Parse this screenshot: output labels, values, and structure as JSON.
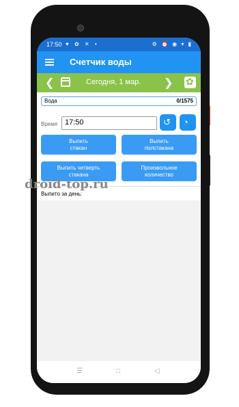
{
  "status_bar": {
    "time": "17:50",
    "left_icons": "♥ ✿ ✕ •",
    "right_icons": "⚙ ⏰ ◉ ▾ ▮"
  },
  "app_bar": {
    "title": "Счетчик воды"
  },
  "date_bar": {
    "date": "Сегодня, 1 мар."
  },
  "progress": {
    "label": "Вода",
    "value": "0/1575",
    "fraction": 0
  },
  "time_row": {
    "label": "Время",
    "value": "17:50"
  },
  "buttons": [
    {
      "line1": "Выпить",
      "line2": "стакан"
    },
    {
      "line1": "Выпить",
      "line2": "полстакана"
    },
    {
      "line1": "Выпить четверть",
      "line2": "стакана"
    },
    {
      "line1": "Произвольное",
      "line2": "количество"
    }
  ],
  "drank_label": "Выпито за день:",
  "watermark": "droid-top.ru",
  "icons": {
    "menu": "hamburger-icon",
    "prev": "chevron-left-icon",
    "calendar": "calendar-icon",
    "next": "chevron-right-icon",
    "settings": "gear-icon",
    "history": "history-icon",
    "clock": "pie-clock-icon"
  },
  "colors": {
    "status": "#1a6fd1",
    "appbar": "#2193f3",
    "datebar": "#8bc34a",
    "button": "#3a9bf5"
  }
}
